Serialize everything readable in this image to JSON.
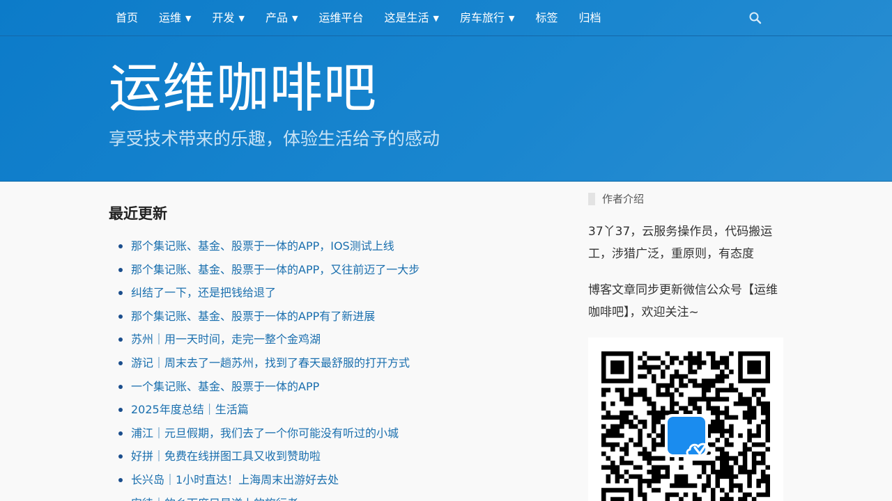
{
  "nav": {
    "items": [
      {
        "label": "首页",
        "dropdown": false
      },
      {
        "label": "运维",
        "dropdown": true
      },
      {
        "label": "开发",
        "dropdown": true
      },
      {
        "label": "产品",
        "dropdown": true
      },
      {
        "label": "运维平台",
        "dropdown": false
      },
      {
        "label": "这是生活",
        "dropdown": true
      },
      {
        "label": "房车旅行",
        "dropdown": true
      },
      {
        "label": "标签",
        "dropdown": false
      },
      {
        "label": "归档",
        "dropdown": false
      }
    ],
    "caret": "▼",
    "search_icon": "search-icon"
  },
  "header": {
    "title": "运维咖啡吧",
    "description": "享受技术带来的乐趣，体验生活给予的感动"
  },
  "recent": {
    "title": "最近更新",
    "posts": [
      "那个集记账、基金、股票于一体的APP，IOS测试上线",
      "那个集记账、基金、股票于一体的APP，又往前迈了一大步",
      "纠结了一下，还是把钱给退了",
      "那个集记账、基金、股票于一体的APP有了新进展",
      "苏州｜用一天时间，走完一整个金鸡湖",
      "游记｜周末去了一趟苏州，找到了春天最舒服的打开方式",
      "一个集记账、基金、股票于一体的APP",
      "2025年度总结｜生活篇",
      "浦江｜元旦假期，我们去了一个你可能没有听过的小城",
      "好拼｜免费在线拼图工具又收到赞助啦",
      "长兴岛｜1小时直达！上海周末出游好去处",
      "安徒｜的乡下度目最逆上的旅行者"
    ]
  },
  "sidebar": {
    "widget_title": "作者介绍",
    "about": "37丫37，云服务操作员，代码搬运工，涉猎广泛，重原则，有态度",
    "wechat": "博客文章同步更新微信公众号【运维咖啡吧】，欢迎关注~",
    "qr_icon": "wechat-qr-code"
  },
  "colors": {
    "header_bg": "#1481cc",
    "link": "#1a6fae",
    "qr_logo": "#1a8cef"
  }
}
